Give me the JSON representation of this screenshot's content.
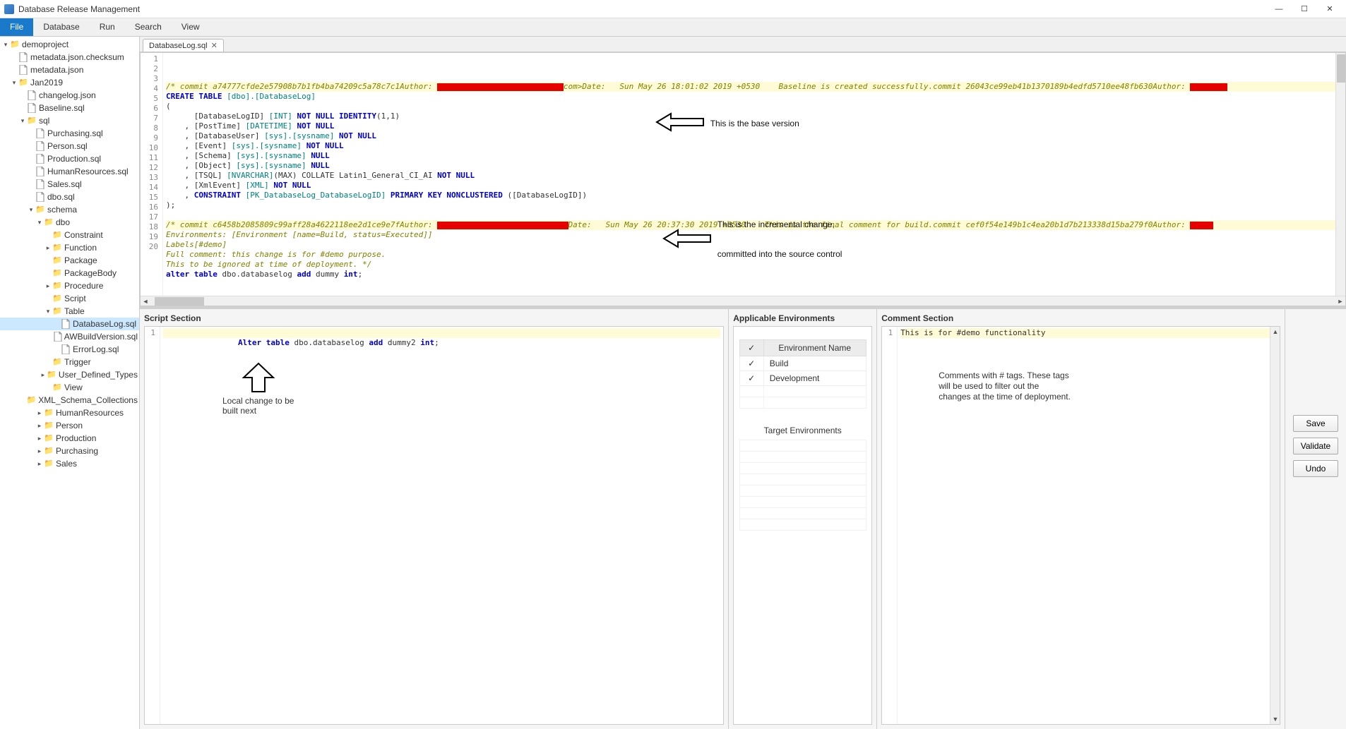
{
  "window": {
    "title": "Database Release Management"
  },
  "menu": {
    "items": [
      "File",
      "Database",
      "Run",
      "Search",
      "View"
    ],
    "active": 0
  },
  "tree": [
    {
      "d": 0,
      "caret": "v",
      "icon": "folder",
      "label": "demoproject"
    },
    {
      "d": 1,
      "caret": "",
      "icon": "file",
      "label": "metadata.json.checksum"
    },
    {
      "d": 1,
      "caret": "",
      "icon": "file",
      "label": "metadata.json"
    },
    {
      "d": 1,
      "caret": "v",
      "icon": "folder",
      "label": "Jan2019"
    },
    {
      "d": 2,
      "caret": "",
      "icon": "file",
      "label": "changelog.json"
    },
    {
      "d": 2,
      "caret": "",
      "icon": "file",
      "label": "Baseline.sql"
    },
    {
      "d": 2,
      "caret": "v",
      "icon": "folder",
      "label": "sql"
    },
    {
      "d": 3,
      "caret": "",
      "icon": "file",
      "label": "Purchasing.sql"
    },
    {
      "d": 3,
      "caret": "",
      "icon": "file",
      "label": "Person.sql"
    },
    {
      "d": 3,
      "caret": "",
      "icon": "file",
      "label": "Production.sql"
    },
    {
      "d": 3,
      "caret": "",
      "icon": "file",
      "label": "HumanResources.sql"
    },
    {
      "d": 3,
      "caret": "",
      "icon": "file",
      "label": "Sales.sql"
    },
    {
      "d": 3,
      "caret": "",
      "icon": "file",
      "label": "dbo.sql"
    },
    {
      "d": 3,
      "caret": "v",
      "icon": "folder",
      "label": "schema"
    },
    {
      "d": 4,
      "caret": "v",
      "icon": "folder",
      "label": "dbo"
    },
    {
      "d": 5,
      "caret": "",
      "icon": "folder",
      "label": "Constraint"
    },
    {
      "d": 5,
      "caret": ">",
      "icon": "folder",
      "label": "Function"
    },
    {
      "d": 5,
      "caret": "",
      "icon": "folder",
      "label": "Package"
    },
    {
      "d": 5,
      "caret": "",
      "icon": "folder",
      "label": "PackageBody"
    },
    {
      "d": 5,
      "caret": ">",
      "icon": "folder",
      "label": "Procedure"
    },
    {
      "d": 5,
      "caret": "",
      "icon": "folder",
      "label": "Script"
    },
    {
      "d": 5,
      "caret": "v",
      "icon": "folder",
      "label": "Table"
    },
    {
      "d": 6,
      "caret": "",
      "icon": "file",
      "label": "DatabaseLog.sql",
      "selected": true
    },
    {
      "d": 6,
      "caret": "",
      "icon": "file",
      "label": "AWBuildVersion.sql"
    },
    {
      "d": 6,
      "caret": "",
      "icon": "file",
      "label": "ErrorLog.sql"
    },
    {
      "d": 5,
      "caret": "",
      "icon": "folder",
      "label": "Trigger"
    },
    {
      "d": 5,
      "caret": ">",
      "icon": "folder",
      "label": "User_Defined_Types"
    },
    {
      "d": 5,
      "caret": "",
      "icon": "folder",
      "label": "View"
    },
    {
      "d": 5,
      "caret": "",
      "icon": "folder",
      "label": "XML_Schema_Collections"
    },
    {
      "d": 4,
      "caret": ">",
      "icon": "folder",
      "label": "HumanResources"
    },
    {
      "d": 4,
      "caret": ">",
      "icon": "folder",
      "label": "Person"
    },
    {
      "d": 4,
      "caret": ">",
      "icon": "folder",
      "label": "Production"
    },
    {
      "d": 4,
      "caret": ">",
      "icon": "folder",
      "label": "Purchasing"
    },
    {
      "d": 4,
      "caret": ">",
      "icon": "folder",
      "label": "Sales"
    }
  ],
  "tab": {
    "label": "DatabaseLog.sql"
  },
  "editor": {
    "lines": [
      {
        "n": 1,
        "hl": true,
        "parts": [
          {
            "c": "cmt",
            "t": "/* commit a74777cfde2e57908b7b1fb4ba74209c5a78c7c1Author: "
          },
          {
            "c": "redact",
            "t": "xxxxxxxxxxxxxxxxxxxxxxxxxxx"
          },
          {
            "c": "cmt",
            "t": "com>Date:   Sun May 26 18:01:02 2019 +0530    Baseline is created successfully.commit 26043ce99eb41b1370189b4edfd5710ee48fb630Author: "
          },
          {
            "c": "redact",
            "t": "xxxxxxxx"
          }
        ]
      },
      {
        "n": 2,
        "parts": [
          {
            "c": "kw",
            "t": "CREATE TABLE"
          },
          {
            "c": "",
            "t": " "
          },
          {
            "c": "ident",
            "t": "[dbo].[DatabaseLog]"
          }
        ]
      },
      {
        "n": 3,
        "parts": [
          {
            "c": "",
            "t": "("
          }
        ]
      },
      {
        "n": 4,
        "parts": [
          {
            "c": "",
            "t": "      [DatabaseLogID] "
          },
          {
            "c": "type",
            "t": "[INT]"
          },
          {
            "c": "",
            "t": " "
          },
          {
            "c": "kw",
            "t": "NOT NULL IDENTITY"
          },
          {
            "c": "",
            "t": "(1,1)"
          }
        ]
      },
      {
        "n": 5,
        "parts": [
          {
            "c": "",
            "t": "    , [PostTime] "
          },
          {
            "c": "type",
            "t": "[DATETIME]"
          },
          {
            "c": "",
            "t": " "
          },
          {
            "c": "kw",
            "t": "NOT NULL"
          }
        ]
      },
      {
        "n": 6,
        "parts": [
          {
            "c": "",
            "t": "    , [DatabaseUser] "
          },
          {
            "c": "type",
            "t": "[sys].[sysname]"
          },
          {
            "c": "",
            "t": " "
          },
          {
            "c": "kw",
            "t": "NOT NULL"
          }
        ]
      },
      {
        "n": 7,
        "parts": [
          {
            "c": "",
            "t": "    , [Event] "
          },
          {
            "c": "type",
            "t": "[sys].[sysname]"
          },
          {
            "c": "",
            "t": " "
          },
          {
            "c": "kw",
            "t": "NOT NULL"
          }
        ]
      },
      {
        "n": 8,
        "parts": [
          {
            "c": "",
            "t": "    , [Schema] "
          },
          {
            "c": "type",
            "t": "[sys].[sysname]"
          },
          {
            "c": "",
            "t": " "
          },
          {
            "c": "kw",
            "t": "NULL"
          }
        ]
      },
      {
        "n": 9,
        "parts": [
          {
            "c": "",
            "t": "    , [Object] "
          },
          {
            "c": "type",
            "t": "[sys].[sysname]"
          },
          {
            "c": "",
            "t": " "
          },
          {
            "c": "kw",
            "t": "NULL"
          }
        ]
      },
      {
        "n": 10,
        "parts": [
          {
            "c": "",
            "t": "    , [TSQL] "
          },
          {
            "c": "type",
            "t": "[NVARCHAR]"
          },
          {
            "c": "",
            "t": "(MAX) COLLATE Latin1_General_CI_AI "
          },
          {
            "c": "kw",
            "t": "NOT NULL"
          }
        ]
      },
      {
        "n": 11,
        "parts": [
          {
            "c": "",
            "t": "    , [XmlEvent] "
          },
          {
            "c": "type",
            "t": "[XML]"
          },
          {
            "c": "",
            "t": " "
          },
          {
            "c": "kw",
            "t": "NOT NULL"
          }
        ]
      },
      {
        "n": 12,
        "parts": [
          {
            "c": "",
            "t": "    , "
          },
          {
            "c": "kw",
            "t": "CONSTRAINT"
          },
          {
            "c": "",
            "t": " "
          },
          {
            "c": "ident",
            "t": "[PK_DatabaseLog_DatabaseLogID]"
          },
          {
            "c": "",
            "t": " "
          },
          {
            "c": "kw",
            "t": "PRIMARY KEY NONCLUSTERED"
          },
          {
            "c": "",
            "t": " ([DatabaseLogID])"
          }
        ]
      },
      {
        "n": 13,
        "parts": [
          {
            "c": "",
            "t": ");"
          }
        ]
      },
      {
        "n": 14,
        "parts": [
          {
            "c": "",
            "t": ""
          }
        ]
      },
      {
        "n": 15,
        "hl": true,
        "parts": [
          {
            "c": "cmt",
            "t": "/* commit c6458b2085809c99aff28a4622118ee2d1ce9e7fAuthor: "
          },
          {
            "c": "redact",
            "t": "xxxxxxxxxxxxxxxxxxxxxxxxxxxx"
          },
          {
            "c": "cmt",
            "t": "Date:   Sun May 26 20:37:30 2019 +0530    This is the final comment for build.commit cef0f54e149b1c4ea20b1d7b213338d15ba279f0Author: "
          },
          {
            "c": "redact",
            "t": "xxxxx"
          }
        ]
      },
      {
        "n": 16,
        "parts": [
          {
            "c": "cmt",
            "t": "Environments: [Environment [name=Build, status=Executed]]"
          }
        ]
      },
      {
        "n": 17,
        "parts": [
          {
            "c": "cmt",
            "t": "Labels[#demo]"
          }
        ]
      },
      {
        "n": 18,
        "parts": [
          {
            "c": "cmt",
            "t": "Full comment: this change is for #demo purpose."
          }
        ]
      },
      {
        "n": 19,
        "parts": [
          {
            "c": "cmt",
            "t": "This to be ignored at time of deployment. */"
          }
        ]
      },
      {
        "n": 20,
        "parts": [
          {
            "c": "kw",
            "t": "alter table"
          },
          {
            "c": "",
            "t": " dbo.databaselog "
          },
          {
            "c": "kw",
            "t": "add"
          },
          {
            "c": "",
            "t": " dummy "
          },
          {
            "c": "kw",
            "t": "int"
          },
          {
            "c": "",
            "t": ";"
          }
        ]
      }
    ],
    "annot1": "This is the base version",
    "annot2a": "This is the incremental change,",
    "annot2b": "committed into the source control"
  },
  "panels": {
    "script": {
      "title": "Script Section",
      "line": "Alter table dbo.databaselog add dummy2 int;",
      "annot1": "Local change to be",
      "annot2": "built next"
    },
    "env": {
      "title": "Applicable Environments",
      "col_check": "✓",
      "col_name": "Environment Name",
      "rows": [
        {
          "checked": true,
          "name": "Build"
        },
        {
          "checked": true,
          "name": "Development"
        }
      ],
      "target_title": "Target Environments"
    },
    "comment": {
      "title": "Comment Section",
      "line": "This is for #demo functionality",
      "annot1": "Comments with # tags. These tags",
      "annot2": "will be used to filter out the",
      "annot3": "changes at the time of deployment."
    },
    "buttons": {
      "save": "Save",
      "validate": "Validate",
      "undo": "Undo"
    }
  }
}
